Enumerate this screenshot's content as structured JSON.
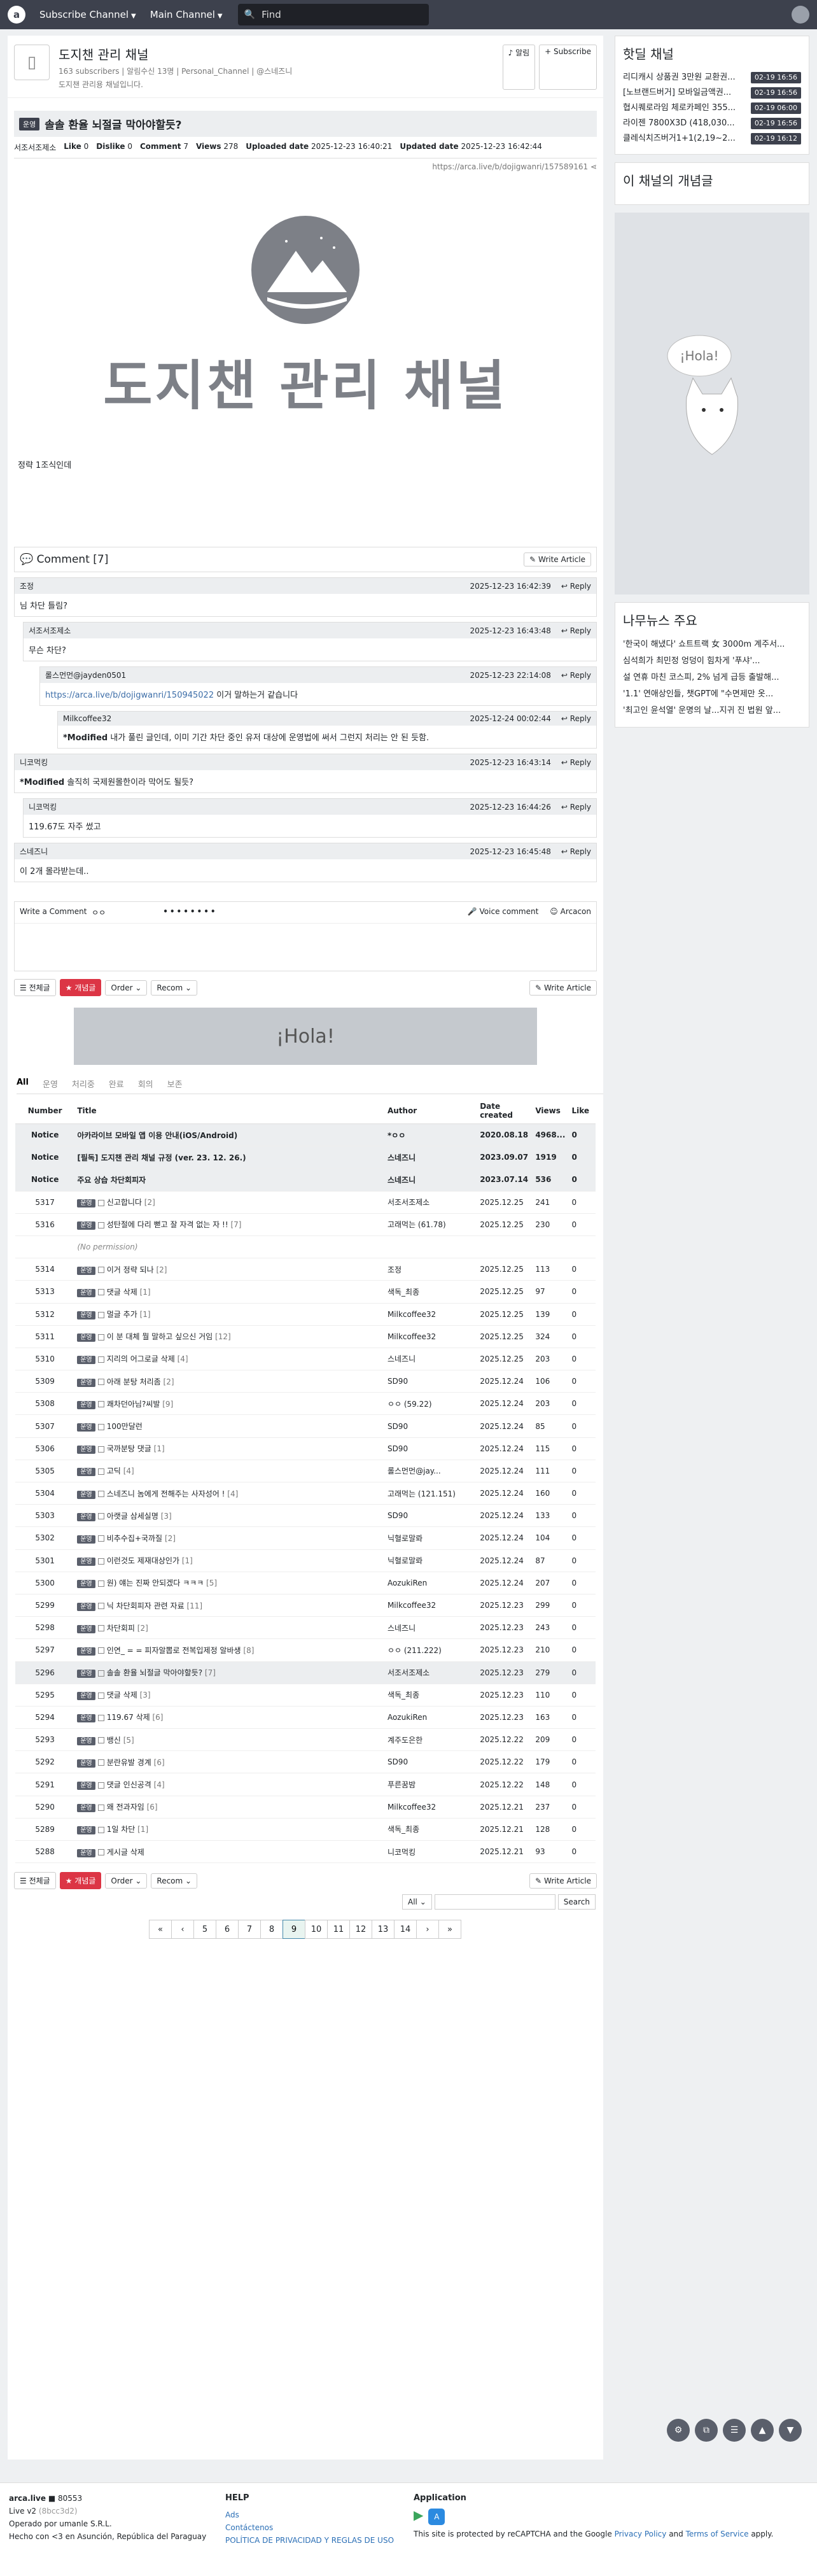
{
  "nav": {
    "subscribe": "Subscribe Channel",
    "main": "Main Channel",
    "search_placeholder": "Find"
  },
  "channel": {
    "title": "도지챈 관리 채널",
    "meta": "163 subscribers | 알림수신 13명 | Personal_Channel | @스네즈니",
    "desc": "도지챈 관리용 채널입니다.",
    "alert_btn": "알림",
    "subscribe_btn": "Subscribe"
  },
  "article": {
    "category": "운영",
    "title": "솔솔 환율 뇌절글 막아야할듯?",
    "author": "서조서조제소",
    "like_label": "Like",
    "like": "0",
    "dislike_label": "Dislike",
    "dislike": "0",
    "comment_label": "Comment",
    "comment": "7",
    "views_label": "Views",
    "views": "278",
    "uploaded_label": "Uploaded date",
    "uploaded": "2025-12-23 16:40:21",
    "updated_label": "Updated date",
    "updated": "2025-12-23 16:42:44",
    "url": "https://arca.live/b/dojigwanri/157589161",
    "banner_name": "도지챈 관리 채널",
    "body": "정략 1조식인데"
  },
  "comments_header": {
    "label": "Comment [7]",
    "write": "Write Article"
  },
  "comments": [
    {
      "author": "조정",
      "date": "2025-12-23 16:42:39",
      "reply": "Reply",
      "text": "님 차단 틀림?"
    },
    {
      "author": "서조서조제소",
      "date": "2025-12-23 16:43:48",
      "reply": "Reply",
      "text": "무슨 차단?"
    },
    {
      "author": "롤스먼먼@jayden0501",
      "date": "2025-12-23 22:14:08",
      "reply": "Reply",
      "link": "https://arca.live/b/dojigwanri/150945022",
      "text": "이거 말하는거 같습니다"
    },
    {
      "author": "Milkcoffee32",
      "date": "2025-12-24 00:02:44",
      "reply": "Reply",
      "mark": "*Modified",
      "text": "내가 풀린 글인데, 이미 기간 차단 중인 유저 대상에 운영법에 써서 그런지 처리는 안 된 듯함."
    },
    {
      "author": "니코먹킹",
      "date": "2025-12-23 16:43:14",
      "reply": "Reply",
      "mark": "*Modified",
      "text": "솔직히 국제원몰한이라 막어도 될듯?"
    },
    {
      "author": "니코먹킹",
      "date": "2025-12-23 16:44:26",
      "reply": "Reply",
      "text": "119.67도 자주 썼고"
    },
    {
      "author": "스네즈니",
      "date": "2025-12-23 16:45:48",
      "reply": "Reply",
      "text": "이 2개 몰라받는데.."
    }
  ],
  "writer": {
    "label": "Write a Comment",
    "user": "ㅇㅇ",
    "dots": "••••••••",
    "voice": "Voice comment",
    "arcacon": "Arcacon"
  },
  "list_bar": {
    "all": "전체글",
    "best": "개념글",
    "order": "Order",
    "recom": "Recom",
    "write": "Write Article"
  },
  "ad_text": "¡Hola!",
  "tabs": [
    "All",
    "운영",
    "처리중",
    "완료",
    "회의",
    "보존"
  ],
  "table_headers": [
    "Number",
    "Title",
    "Author",
    "Date created",
    "Views",
    "Like"
  ],
  "rows": [
    {
      "n": "Notice",
      "badge": "",
      "title": "아카라이브 모바일 앱 이용 안내(iOS/Android)",
      "cnt": "",
      "author": "*ㅇㅇ",
      "date": "2020.08.18",
      "views": "4968...",
      "like": "0",
      "notice": true
    },
    {
      "n": "Notice",
      "badge": "",
      "title": "[필독] 도지챈 관리 채널 규정 (ver. 23. 12. 26.)",
      "cnt": "",
      "author": "스네즈니",
      "date": "2023.09.07",
      "views": "1919",
      "like": "0",
      "notice": true
    },
    {
      "n": "Notice",
      "badge": "",
      "title": "주요 상습 차단회피자",
      "cnt": "",
      "author": "스네즈니",
      "date": "2023.07.14",
      "views": "536",
      "like": "0",
      "notice": true
    },
    {
      "n": "5317",
      "badge": "운영",
      "title": "신고합니다",
      "cnt": "[2]",
      "author": "서조서조제소",
      "date": "2025.12.25",
      "views": "241",
      "like": "0"
    },
    {
      "n": "5316",
      "badge": "운영",
      "title": "성탄절에 다리 뻗고 잘 자격 없는 자 !!",
      "cnt": "[7]",
      "author": "고래먹는 (61.78)",
      "date": "2025.12.25",
      "views": "230",
      "like": "0"
    },
    {
      "n": "",
      "badge": "",
      "title": "(No permission)",
      "cnt": "",
      "author": "",
      "date": "",
      "views": "",
      "like": "",
      "np": true
    },
    {
      "n": "5314",
      "badge": "운영",
      "title": "이거 정략 되나",
      "cnt": "[2]",
      "author": "조정",
      "date": "2025.12.25",
      "views": "113",
      "like": "0"
    },
    {
      "n": "5313",
      "badge": "운영",
      "title": "댓글 삭제",
      "cnt": "[1]",
      "author": "색독_최종",
      "date": "2025.12.25",
      "views": "97",
      "like": "0"
    },
    {
      "n": "5312",
      "badge": "운영",
      "title": "멀글 추가",
      "cnt": "[1]",
      "author": "Milkcoffee32",
      "date": "2025.12.25",
      "views": "139",
      "like": "0"
    },
    {
      "n": "5311",
      "badge": "운영",
      "title": "이 분 대체 뭘 말하고 싶으신 거임",
      "cnt": "[12]",
      "author": "Milkcoffee32",
      "date": "2025.12.25",
      "views": "324",
      "like": "0"
    },
    {
      "n": "5310",
      "badge": "운영",
      "title": "지리의 어그로글 삭제",
      "cnt": "[4]",
      "author": "스네즈니",
      "date": "2025.12.25",
      "views": "203",
      "like": "0"
    },
    {
      "n": "5309",
      "badge": "운영",
      "title": "아래 분탕 처리좀",
      "cnt": "[2]",
      "author": "SD90",
      "date": "2025.12.24",
      "views": "106",
      "like": "0"
    },
    {
      "n": "5308",
      "badge": "운영",
      "title": "쾌차던아님?씨발",
      "cnt": "[9]",
      "author": "ㅇㅇ (59.22)",
      "date": "2025.12.24",
      "views": "203",
      "like": "0"
    },
    {
      "n": "5307",
      "badge": "운영",
      "title": "100만달런",
      "cnt": "",
      "author": "SD90",
      "date": "2025.12.24",
      "views": "85",
      "like": "0"
    },
    {
      "n": "5306",
      "badge": "운영",
      "title": "국까분탕 댓글",
      "cnt": "[1]",
      "author": "SD90",
      "date": "2025.12.24",
      "views": "115",
      "like": "0"
    },
    {
      "n": "5305",
      "badge": "운영",
      "title": "고딕",
      "cnt": "[4]",
      "author": "롤스먼먼@jay...",
      "date": "2025.12.24",
      "views": "111",
      "like": "0"
    },
    {
      "n": "5304",
      "badge": "운영",
      "title": "스네즈니 놈에게 전해주는 사자성어 !",
      "cnt": "[4]",
      "author": "고래먹는 (121.151)",
      "date": "2025.12.24",
      "views": "160",
      "like": "0"
    },
    {
      "n": "5303",
      "badge": "운영",
      "title": "아랫글 삼세실명",
      "cnt": "[3]",
      "author": "SD90",
      "date": "2025.12.24",
      "views": "133",
      "like": "0"
    },
    {
      "n": "5302",
      "badge": "운영",
      "title": "비추수집+국까질",
      "cnt": "[2]",
      "author": "닉혈로말롸",
      "date": "2025.12.24",
      "views": "104",
      "like": "0"
    },
    {
      "n": "5301",
      "badge": "운영",
      "title": "이런것도 제재대상인가",
      "cnt": "[1]",
      "author": "닉혈로말롸",
      "date": "2025.12.24",
      "views": "87",
      "like": "0"
    },
    {
      "n": "5300",
      "badge": "운영",
      "title": "원) 얘는 진짜 안되겠다 ㅋㅋㅋ",
      "cnt": "[5]",
      "author": "AozukiRen",
      "date": "2025.12.24",
      "views": "207",
      "like": "0"
    },
    {
      "n": "5299",
      "badge": "운영",
      "title": "닉 차단회피자 관련 자료",
      "cnt": "[11]",
      "author": "Milkcoffee32",
      "date": "2025.12.23",
      "views": "299",
      "like": "0"
    },
    {
      "n": "5298",
      "badge": "운영",
      "title": "차단회피",
      "cnt": "[2]",
      "author": "스네즈니",
      "date": "2025.12.23",
      "views": "243",
      "like": "0"
    },
    {
      "n": "5297",
      "badge": "운영",
      "title": "인연_ = = 피자알뽑로 전복입제정 알바생",
      "cnt": "[8]",
      "author": "ㅇㅇ (211.222)",
      "date": "2025.12.23",
      "views": "210",
      "like": "0"
    },
    {
      "n": "5296",
      "badge": "운영",
      "title": "솔솔 환율 뇌절글 막아야할듯?",
      "cnt": "[7]",
      "author": "서조서조제소",
      "date": "2025.12.23",
      "views": "279",
      "like": "0",
      "cur": true
    },
    {
      "n": "5295",
      "badge": "운영",
      "title": "댓글 삭제",
      "cnt": "[3]",
      "author": "색독_최종",
      "date": "2025.12.23",
      "views": "110",
      "like": "0"
    },
    {
      "n": "5294",
      "badge": "운영",
      "title": "119.67 삭제",
      "cnt": "[6]",
      "author": "AozukiRen",
      "date": "2025.12.23",
      "views": "163",
      "like": "0"
    },
    {
      "n": "5293",
      "badge": "운영",
      "title": "뱅신",
      "cnt": "[5]",
      "author": "계주도은한",
      "date": "2025.12.22",
      "views": "209",
      "like": "0"
    },
    {
      "n": "5292",
      "badge": "운영",
      "title": "분란유발 경계",
      "cnt": "[6]",
      "author": "SD90",
      "date": "2025.12.22",
      "views": "179",
      "like": "0"
    },
    {
      "n": "5291",
      "badge": "운영",
      "title": "댓글 인신공격",
      "cnt": "[4]",
      "author": "푸른꿈밤",
      "date": "2025.12.22",
      "views": "148",
      "like": "0"
    },
    {
      "n": "5290",
      "badge": "운영",
      "title": "왜 전과자임",
      "cnt": "[6]",
      "author": "Milkcoffee32",
      "date": "2025.12.21",
      "views": "237",
      "like": "0"
    },
    {
      "n": "5289",
      "badge": "운영",
      "title": "1일 차단",
      "cnt": "[1]",
      "author": "색독_최종",
      "date": "2025.12.21",
      "views": "128",
      "like": "0"
    },
    {
      "n": "5288",
      "badge": "운영",
      "title": "게시글 삭제",
      "cnt": "",
      "author": "니코먹킹",
      "date": "2025.12.21",
      "views": "93",
      "like": "0"
    }
  ],
  "search_form": {
    "scope": "All",
    "button": "Search"
  },
  "pages": [
    "«",
    "‹",
    "5",
    "6",
    "7",
    "8",
    "9",
    "10",
    "11",
    "12",
    "13",
    "14",
    "›",
    "»"
  ],
  "current_page": "9",
  "sidebar": {
    "hot_title": "핫딜 채널",
    "hot": [
      {
        "t": "리디캐시 상품권 3만원 교환권...",
        "time": "02-19 16:56"
      },
      {
        "t": "[노브랜드버거] 모바일금액권...",
        "time": "02-19 16:56"
      },
      {
        "t": "협시퀘로라임 체로카페인 355...",
        "time": "02-19 06:00"
      },
      {
        "t": "라이젠 7800X3D (418,030...",
        "time": "02-19 16:56"
      },
      {
        "t": "클레식치즈버거1+1(2,19~2...",
        "time": "02-19 16:12"
      }
    ],
    "best_title": "이 채널의 개념글",
    "news_title": "나무뉴스 주요",
    "news": [
      "'한국이 해냈다' 쇼트트랙 女 3000m 계주서...",
      "심석희가 최민정 엉덩이 힘차게 '푸샤'...",
      "설 연휴 마친 코스피, 2% 넘게 급등 출발해...",
      "'1.1' 연애상인들, 챗GPT에 \"수면제만 옷...",
      "'최고인 윤석열' 운명의 날...지귀 진 법원 앞..."
    ]
  },
  "footer": {
    "site": "arca.live",
    "build": "■ 80553",
    "version": "Live v2",
    "version_tag": "(8bcc3d2)",
    "operator": "Operado por umanle S.R.L.",
    "made": "Hecho con <3 en Asunción, República del Paraguay",
    "help_title": "HELP",
    "ads": "Ads",
    "contact": "Contáctenos",
    "privacy": "POLÍTICA DE PRIVACIDAD Y REGLAS DE USO",
    "app_title": "Application",
    "recaptcha": "This site is protected by reCAPTCHA and the Google",
    "pp": "Privacy Policy",
    "and": "and",
    "tos": "Terms of Service",
    "apply": "apply."
  },
  "colors": {
    "nav": "#3d414d",
    "accent": "#dc3545",
    "link": "#2b6fb6"
  }
}
